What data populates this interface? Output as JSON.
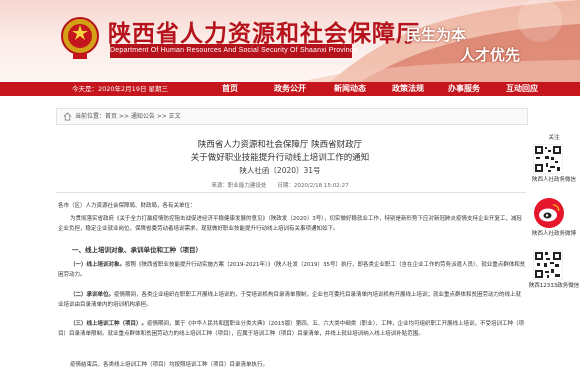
{
  "header": {
    "site_title": "陕西省人力资源和社会保障厅",
    "site_subtitle": "Department Of Human Resources And Social Security Of Shaanxi Province",
    "slogan_line1": "民生为本",
    "slogan_line2": "人才优先"
  },
  "nav": {
    "date_text": "今天是：2020年2月19日 星期三",
    "items": [
      "首页",
      "政务公开",
      "新闻动态",
      "政策法规",
      "办事服务",
      "互动回应"
    ]
  },
  "breadcrumb": {
    "text": "当前位置：首页 >> 通知公告 >> 正文"
  },
  "article": {
    "title_line1": "陕西省人力资源和社会保障厅 陕西省财政厅",
    "title_line2": "关于做好职业技能提升行动线上培训工作的通知",
    "doc_number": "陕人社函〔2020〕31号",
    "meta": "来源：职业能力建设处　　日期：2020/2/18 15:02:27",
    "salutation": "各市（区）人力资源社会保障局、财政局，各有关单位：",
    "intro": "为贯彻落实省政府《关于全力打赢疫情防控阻击战促进经济平稳健康发展的意见》（陕政发〔2020〕3号），切实做好稳就业工作，特别是新形势下应对新冠肺炎疫情支持企业开复工，减轻企业负担，稳定企业就业岗位，保障省委劳动者培训需求，现就做好职业技能提升行动线上培训有关事项通知如下。",
    "section1": "一、线上培训对象、承训单位和工种（项目）",
    "p1_label": "（一）线上培训对象。",
    "p1": "按照《陕西省职业技能提升行动实施方案（2019-2021年）》（陕人社发〔2019〕35号）执行，即各类企业职工（含在企业工作的劳务派遣人员）、就业重点群体和贫困劳动力。",
    "p2_label": "（二）承训单位。",
    "p2": "疫情期间，各类企业组织在职职工开展线上培训的，于受培训机构目录清单限制，企业也可委托目录清单内培训机构开展线上培训；就业重点群体和贫困劳动力的线上就业培训由目录清单内的培训机构承担。",
    "p3_label": "（三）线上培训工种（项目）。",
    "p3": "疫情期间，属于《中华人民共和国职业分类大典》（2015版）第四、五、六大类中细类（职业）、工种，企业均可组织职工开展线上培训，不受培训工种（项目）目录清单限制。就业重点群体和贫困劳动力的线上培训工种（项目），应属于培训工种（项目）目录清单，并线上就业培训纳入线上培训补贴范围。",
    "p4": "疫情结束后，各类线上培训工种（项目）均按照培训工种（项目）目录清单执行。"
  },
  "sidebar": {
    "label_top": "关注",
    "qr1_caption": "陕西人社政务微信",
    "weibo_caption": "陕西人社政务微博",
    "qr2_caption": "陕西12333政务微信"
  },
  "colors": {
    "brand_red": "#c4161c",
    "title_red": "#b5121b"
  }
}
